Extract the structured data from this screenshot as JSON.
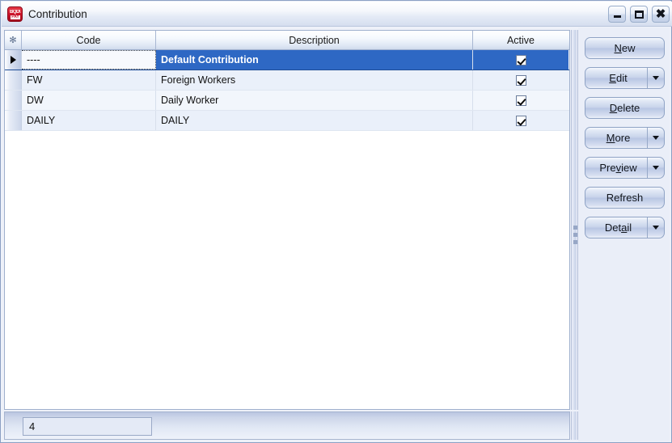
{
  "window": {
    "title": "Contribution",
    "app_icon": "application-icon",
    "icon_glyph_top": "BQD\\",
    "icon_glyph_bottom": "PAY",
    "controls": {
      "minimize_label": "Minimize",
      "maximize_label": "Maximize",
      "close_label": "Close"
    }
  },
  "grid": {
    "columns": [
      {
        "key": "indicator",
        "label": "✻"
      },
      {
        "key": "code",
        "label": "Code"
      },
      {
        "key": "description",
        "label": "Description"
      },
      {
        "key": "active",
        "label": "Active"
      }
    ],
    "rows": [
      {
        "code": "----",
        "description": "Default Contribution",
        "active": true,
        "selected": true
      },
      {
        "code": "FW",
        "description": "Foreign Workers",
        "active": true,
        "selected": false
      },
      {
        "code": "DW",
        "description": "Daily Worker",
        "active": true,
        "selected": false
      },
      {
        "code": "DAILY",
        "description": "DAILY",
        "active": true,
        "selected": false
      }
    ]
  },
  "buttons": [
    {
      "id": "new",
      "label": "New",
      "mnemonic": "N",
      "dropdown": false
    },
    {
      "id": "edit",
      "label": "Edit",
      "mnemonic": "E",
      "dropdown": true
    },
    {
      "id": "delete",
      "label": "Delete",
      "mnemonic": "D",
      "dropdown": false
    },
    {
      "id": "more",
      "label": "More",
      "mnemonic": "M",
      "dropdown": true
    },
    {
      "id": "preview",
      "label": "Preview",
      "mnemonic": "v",
      "dropdown": true
    },
    {
      "id": "refresh",
      "label": "Refresh",
      "mnemonic": "",
      "dropdown": false
    },
    {
      "id": "detail",
      "label": "Detail",
      "mnemonic": "a",
      "dropdown": true
    }
  ],
  "statusbar": {
    "record_count": "4"
  },
  "colors": {
    "selection": "#2e68c4",
    "window_border": "#8ba0c4",
    "panel_background": "#eaeef8",
    "accent_icon": "#c81028"
  }
}
